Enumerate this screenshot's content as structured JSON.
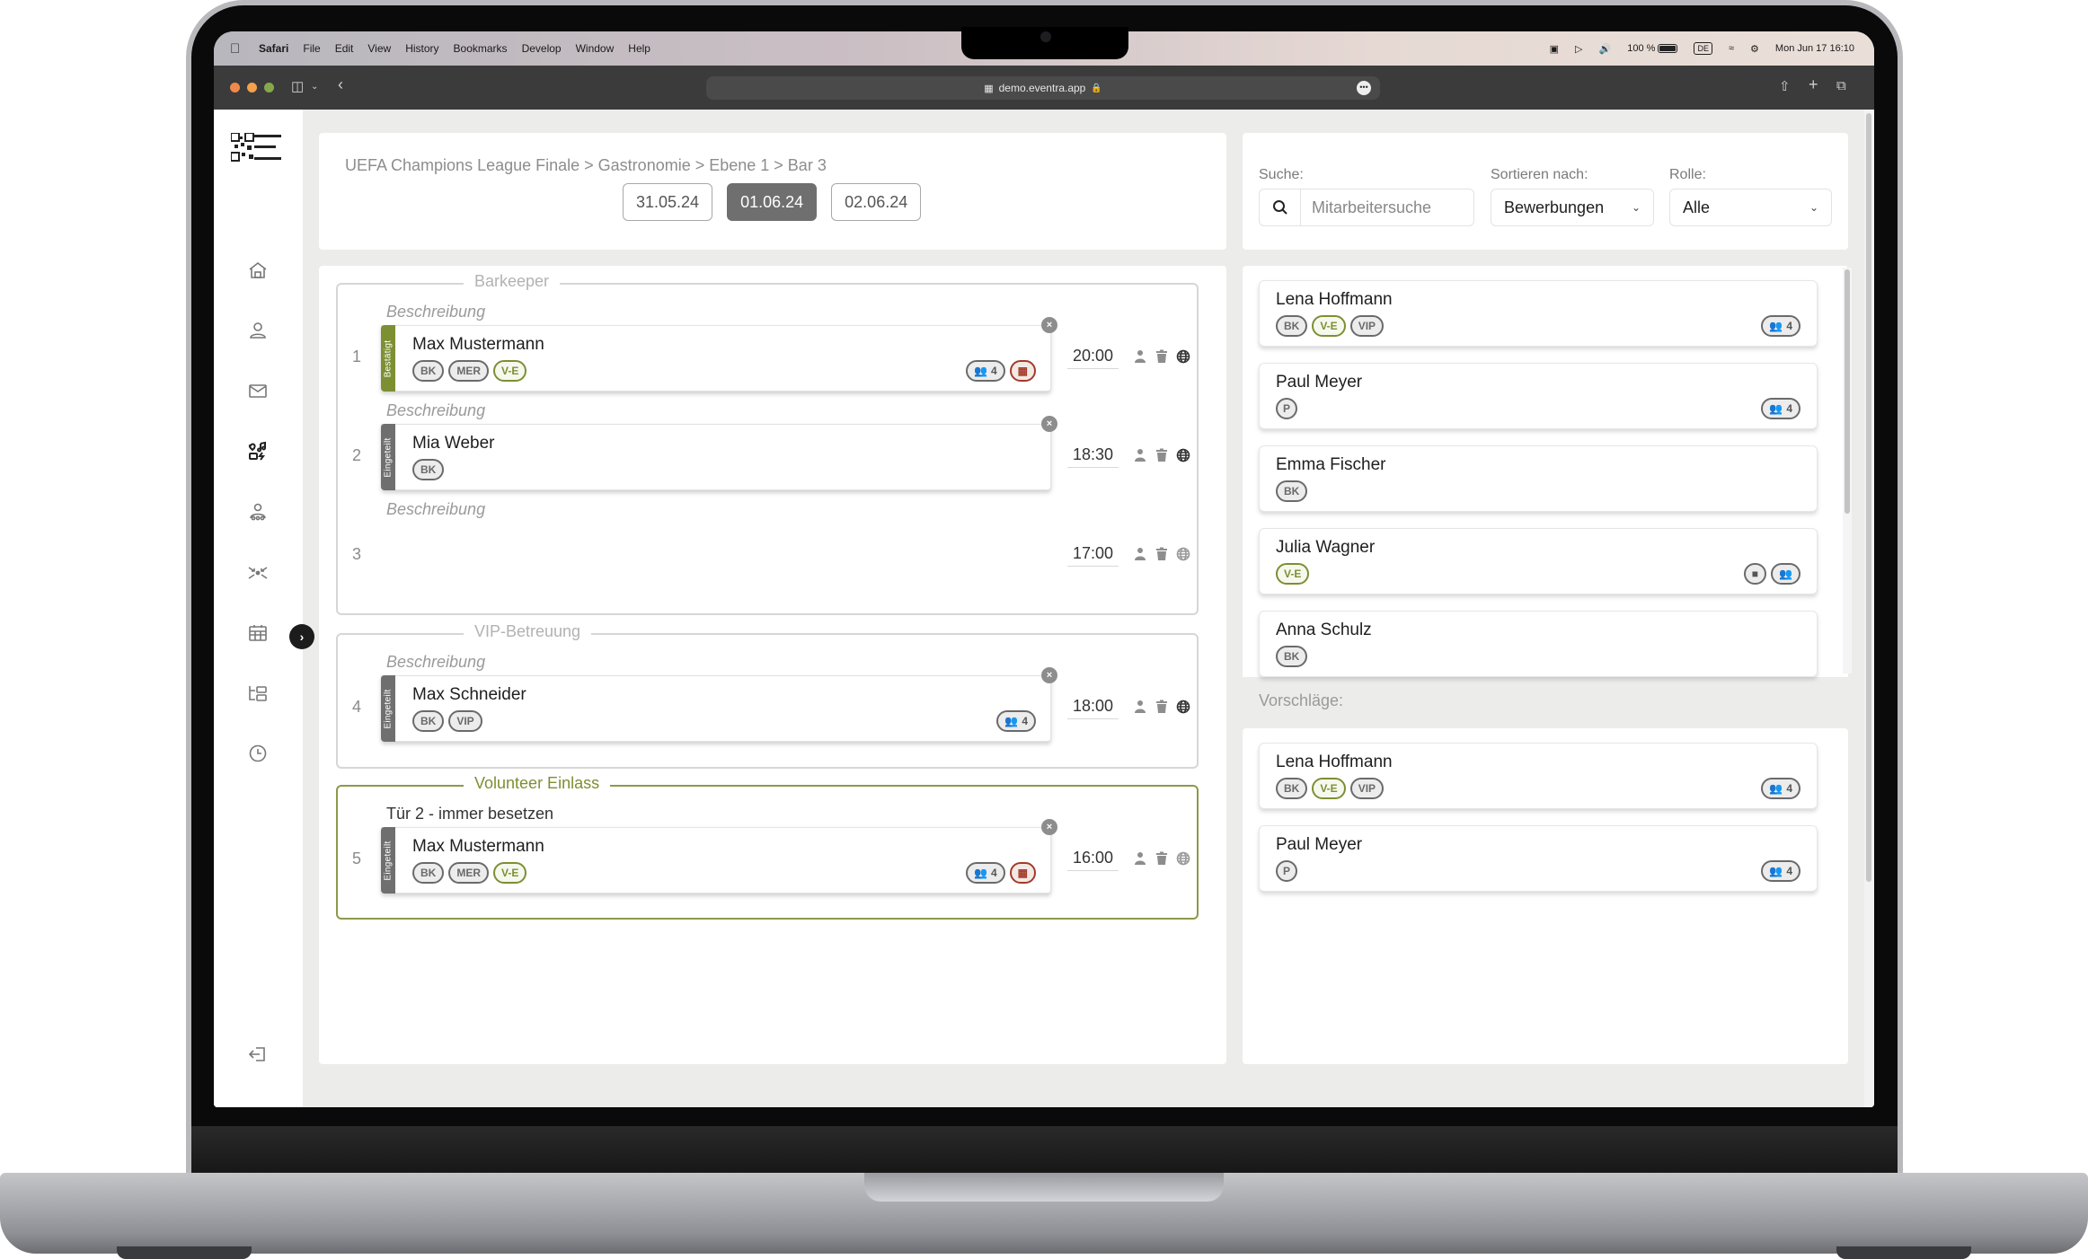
{
  "menubar": {
    "app_name": "Safari",
    "items": [
      "File",
      "Edit",
      "View",
      "History",
      "Bookmarks",
      "Develop",
      "Window",
      "Help"
    ],
    "battery": "100 %",
    "input_source": "DE",
    "datetime": "Mon Jun 17  16:10"
  },
  "browser": {
    "url": "demo.eventra.app",
    "traffic_colors": [
      "#f08a4b",
      "#f5a04a",
      "#86a84a"
    ]
  },
  "colors": {
    "accent_green": "#7c8f32",
    "warning_red": "#a33a2a",
    "status_gray": "#6f6f6f"
  },
  "sidebar": {
    "items": [
      {
        "name": "home",
        "icon": "home-icon"
      },
      {
        "name": "profile",
        "icon": "user-icon"
      },
      {
        "name": "messages",
        "icon": "mail-icon"
      },
      {
        "name": "events",
        "icon": "event-icon",
        "active": true
      },
      {
        "name": "staff",
        "icon": "team-icon"
      },
      {
        "name": "collapse",
        "icon": "compress-icon"
      },
      {
        "name": "calendar",
        "icon": "calendar-icon"
      },
      {
        "name": "structure",
        "icon": "folder-tree-icon"
      },
      {
        "name": "history",
        "icon": "clock-icon"
      }
    ],
    "expand_label": "›",
    "logout_icon": "logout-icon"
  },
  "header": {
    "breadcrumb": "UEFA Champions League Finale > Gastronomie > Ebene 1 > Bar 3",
    "dates": [
      {
        "label": "31.05.24",
        "active": false
      },
      {
        "label": "01.06.24",
        "active": true
      },
      {
        "label": "02.06.24",
        "active": false
      }
    ]
  },
  "groups": [
    {
      "title": "Barkeeper",
      "highlight": false,
      "slots": [
        {
          "num": "1",
          "description": "Beschreibung",
          "time": "20:00",
          "assignment": {
            "name": "Max Mustermann",
            "status": "Bestätigt",
            "status_color": "green",
            "tags": [
              {
                "label": "BK"
              },
              {
                "label": "MER"
              },
              {
                "label": "V-E",
                "green": true
              }
            ],
            "team": "4",
            "calendar_warning": true
          }
        },
        {
          "num": "2",
          "description": "Beschreibung",
          "time": "18:30",
          "assignment": {
            "name": "Mia Weber",
            "status": "Eingeteilt",
            "status_color": "gray",
            "tags": [
              {
                "label": "BK"
              }
            ],
            "team": null,
            "calendar_warning": false
          }
        },
        {
          "num": "3",
          "description": "Beschreibung",
          "time": "17:00",
          "assignment": null
        }
      ]
    },
    {
      "title": "VIP-Betreuung",
      "highlight": false,
      "slots": [
        {
          "num": "4",
          "description": "Beschreibung",
          "time": "18:00",
          "assignment": {
            "name": "Max Schneider",
            "status": "Eingeteilt",
            "status_color": "gray",
            "tags": [
              {
                "label": "BK"
              },
              {
                "label": "VIP"
              }
            ],
            "team": "4",
            "calendar_warning": false
          }
        }
      ]
    },
    {
      "title": "Volunteer Einlass",
      "highlight": true,
      "slots": [
        {
          "num": "5",
          "description": "Tür 2 - immer besetzen",
          "time": "16:00",
          "assignment": {
            "name": "Max Mustermann",
            "status": "Eingeteilt",
            "status_color": "gray",
            "tags": [
              {
                "label": "BK"
              },
              {
                "label": "MER"
              },
              {
                "label": "V-E",
                "green": true
              }
            ],
            "team": "4",
            "calendar_warning": true
          }
        }
      ]
    }
  ],
  "filters": {
    "search_label": "Suche:",
    "search_placeholder": "Mitarbeitersuche",
    "search_value": "",
    "sort_label": "Sortieren nach:",
    "sort_value": "Bewerbungen",
    "role_label": "Rolle:",
    "role_value": "Alle"
  },
  "candidates": [
    {
      "name": "Lena Hoffmann",
      "tags": [
        {
          "label": "BK"
        },
        {
          "label": "V-E",
          "green": true
        },
        {
          "label": "VIP"
        }
      ],
      "team": "4",
      "note": false
    },
    {
      "name": "Paul Meyer",
      "tags": [
        {
          "label": "P"
        }
      ],
      "team": "4",
      "note": false
    },
    {
      "name": "Emma Fischer",
      "tags": [
        {
          "label": "BK"
        }
      ],
      "team": null,
      "note": false
    },
    {
      "name": "Julia Wagner",
      "tags": [
        {
          "label": "V-E",
          "green": true
        }
      ],
      "team": "",
      "note": true
    },
    {
      "name": "Anna Schulz",
      "tags": [
        {
          "label": "BK"
        }
      ],
      "team": null,
      "note": false
    }
  ],
  "suggestions_label": "Vorschläge:",
  "suggestions": [
    {
      "name": "Lena Hoffmann",
      "tags": [
        {
          "label": "BK"
        },
        {
          "label": "V-E",
          "green": true
        },
        {
          "label": "VIP"
        }
      ],
      "team": "4"
    },
    {
      "name": "Paul Meyer",
      "tags": [
        {
          "label": "P"
        }
      ],
      "team": "4"
    }
  ]
}
